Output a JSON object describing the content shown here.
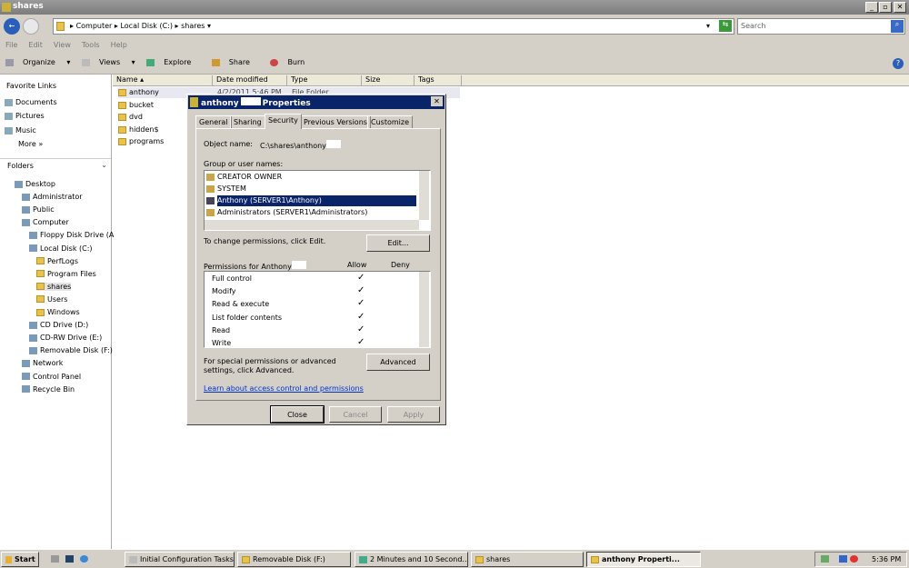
{
  "window": {
    "title": "shares"
  },
  "address": {
    "crumbs": [
      "Computer",
      "Local Disk (C:)",
      "shares"
    ],
    "search_placeholder": "Search"
  },
  "menu": [
    "File",
    "Edit",
    "View",
    "Tools",
    "Help"
  ],
  "toolbar": [
    "Organize",
    "Views",
    "Explore",
    "Share",
    "Burn"
  ],
  "favorites": {
    "heading": "Favorite Links",
    "items": [
      "Documents",
      "Pictures",
      "Music"
    ],
    "more": "More »"
  },
  "folders": {
    "heading": "Folders",
    "items": [
      "Desktop",
      "Administrator",
      "Public",
      "Computer",
      "Floppy Disk Drive (A",
      "Local Disk (C:)",
      "PerfLogs",
      "Program Files",
      "shares",
      "Users",
      "Windows",
      "CD Drive (D:)",
      "CD-RW Drive (E:)",
      "Removable Disk (F:)",
      "Network",
      "Control Panel",
      "Recycle Bin"
    ]
  },
  "columns": [
    "Name",
    "Date modified",
    "Type",
    "Size",
    "Tags"
  ],
  "files": [
    {
      "name": "anthony",
      "date": "4/2/2011 5:46 PM",
      "type": "File Folder"
    },
    {
      "name": "bucket"
    },
    {
      "name": "dvd"
    },
    {
      "name": "hidden$"
    },
    {
      "name": "programs"
    }
  ],
  "dialog": {
    "title_prefix": "anthony",
    "title_suffix": "Properties",
    "tabs": [
      "General",
      "Sharing",
      "Security",
      "Previous Versions",
      "Customize"
    ],
    "active_tab": "Security",
    "object_label": "Object name:",
    "object_value": "C:\\shares\\anthony",
    "group_label": "Group or user names:",
    "users": [
      "CREATOR OWNER",
      "SYSTEM",
      "Anthony (SERVER1\\Anthony)",
      "Administrators (SERVER1\\Administrators)"
    ],
    "change_text": "To change permissions, click Edit.",
    "edit": "Edit...",
    "perm_label": "Permissions for Anthony",
    "allow": "Allow",
    "deny": "Deny",
    "permissions": [
      {
        "name": "Full control",
        "allow": true
      },
      {
        "name": "Modify",
        "allow": true
      },
      {
        "name": "Read & execute",
        "allow": true
      },
      {
        "name": "List folder contents",
        "allow": true
      },
      {
        "name": "Read",
        "allow": true
      },
      {
        "name": "Write",
        "allow": true
      }
    ],
    "check": "✓",
    "special_text": "For special permissions or advanced settings, click Advanced.",
    "advanced": "Advanced",
    "learn_link": "Learn about access control and permissions",
    "close": "Close",
    "cancel": "Cancel",
    "apply": "Apply"
  },
  "taskbar": {
    "start": "Start",
    "items": [
      "Initial Configuration Tasks",
      "Removable Disk (F:)",
      "2 Minutes and 10 Second...",
      "shares",
      "anthony Properti..."
    ],
    "clock": "5:36 PM"
  }
}
